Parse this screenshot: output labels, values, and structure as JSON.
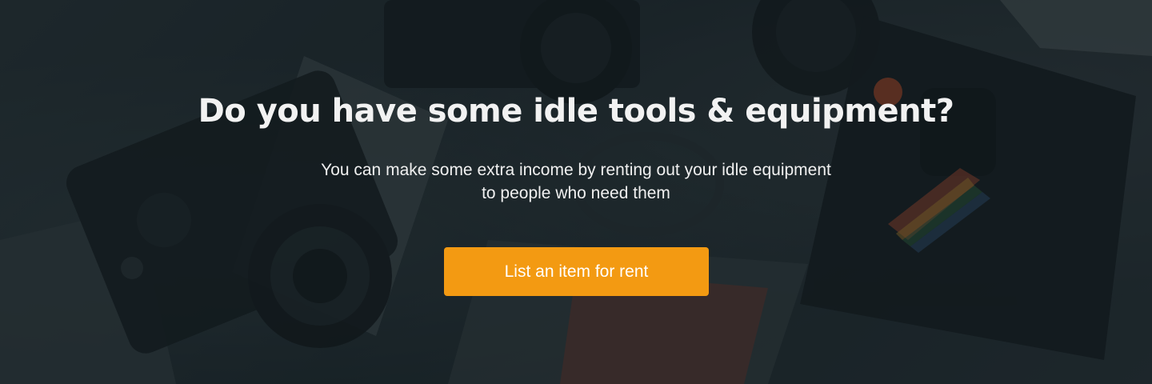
{
  "hero": {
    "headline": "Do you have some idle tools & equipment?",
    "subtext": "You can make some extra income by renting out your idle equipment to people who need them",
    "cta_label": "List an item for rent",
    "accent_color": "#f39a12",
    "background_image": "cameras-and-photo-equipment"
  }
}
